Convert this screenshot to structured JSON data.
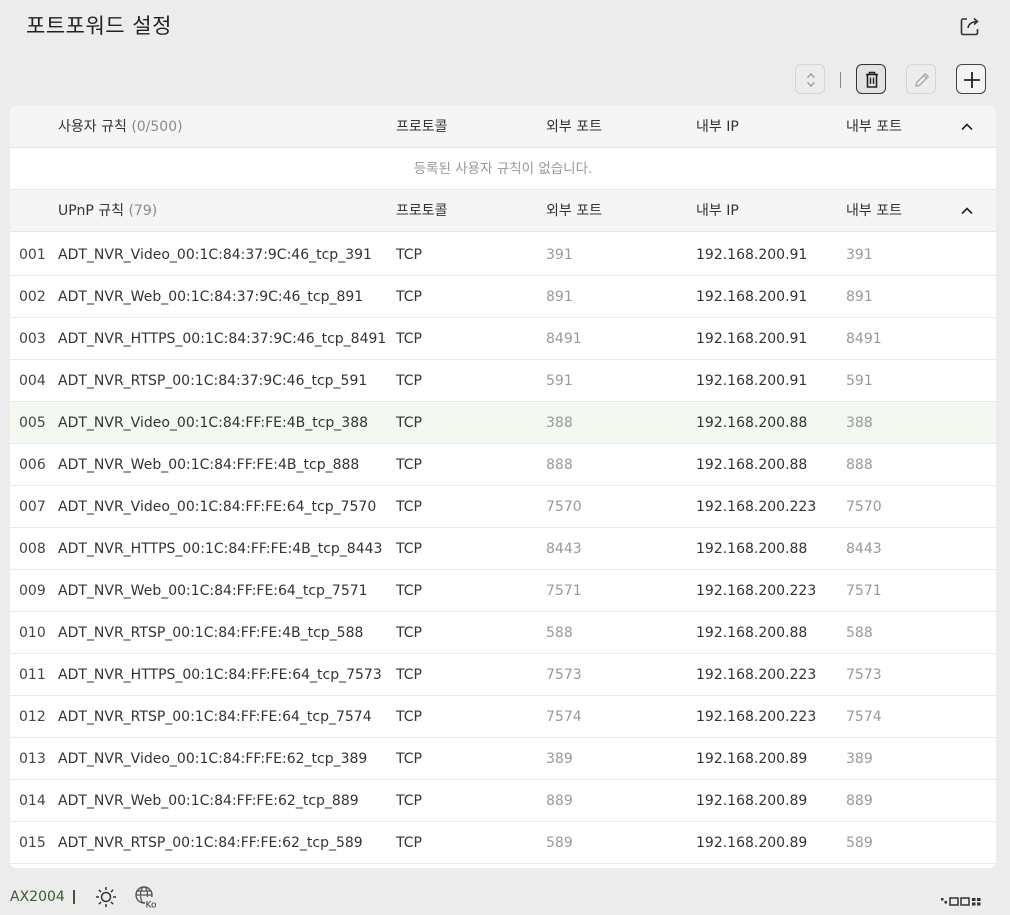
{
  "header": {
    "title": "포트포워드 설정"
  },
  "icons": {
    "export": "export-icon",
    "sort": "sort-icon",
    "delete": "trash-icon",
    "edit": "pencil-icon",
    "add": "plus-icon",
    "collapse": "chevron-up-icon",
    "brightness": "sun-icon",
    "language": "globe-icon",
    "layout": "layout-grid-icon"
  },
  "user_rules": {
    "title": "사용자 규칙",
    "count": "(0/500)",
    "columns": {
      "protocol": "프로토콜",
      "external_port": "외부 포트",
      "internal_ip": "내부 IP",
      "internal_port": "내부 포트"
    },
    "empty_message": "등록된 사용자 규칙이 없습니다."
  },
  "upnp_rules": {
    "title": "UPnP 규칙",
    "count": "(79)",
    "columns": {
      "protocol": "프로토콜",
      "external_port": "외부 포트",
      "internal_ip": "내부 IP",
      "internal_port": "내부 포트"
    },
    "rows": [
      {
        "no": "001",
        "name": "ADT_NVR_Video_00:1C:84:37:9C:46_tcp_391",
        "protocol": "TCP",
        "external_port": "391",
        "internal_ip": "192.168.200.91",
        "internal_port": "391"
      },
      {
        "no": "002",
        "name": "ADT_NVR_Web_00:1C:84:37:9C:46_tcp_891",
        "protocol": "TCP",
        "external_port": "891",
        "internal_ip": "192.168.200.91",
        "internal_port": "891"
      },
      {
        "no": "003",
        "name": "ADT_NVR_HTTPS_00:1C:84:37:9C:46_tcp_8491",
        "protocol": "TCP",
        "external_port": "8491",
        "internal_ip": "192.168.200.91",
        "internal_port": "8491"
      },
      {
        "no": "004",
        "name": "ADT_NVR_RTSP_00:1C:84:37:9C:46_tcp_591",
        "protocol": "TCP",
        "external_port": "591",
        "internal_ip": "192.168.200.91",
        "internal_port": "591"
      },
      {
        "no": "005",
        "name": "ADT_NVR_Video_00:1C:84:FF:FE:4B_tcp_388",
        "protocol": "TCP",
        "external_port": "388",
        "internal_ip": "192.168.200.88",
        "internal_port": "388"
      },
      {
        "no": "006",
        "name": "ADT_NVR_Web_00:1C:84:FF:FE:4B_tcp_888",
        "protocol": "TCP",
        "external_port": "888",
        "internal_ip": "192.168.200.88",
        "internal_port": "888"
      },
      {
        "no": "007",
        "name": "ADT_NVR_Video_00:1C:84:FF:FE:64_tcp_7570",
        "protocol": "TCP",
        "external_port": "7570",
        "internal_ip": "192.168.200.223",
        "internal_port": "7570"
      },
      {
        "no": "008",
        "name": "ADT_NVR_HTTPS_00:1C:84:FF:FE:4B_tcp_8443",
        "protocol": "TCP",
        "external_port": "8443",
        "internal_ip": "192.168.200.88",
        "internal_port": "8443"
      },
      {
        "no": "009",
        "name": "ADT_NVR_Web_00:1C:84:FF:FE:64_tcp_7571",
        "protocol": "TCP",
        "external_port": "7571",
        "internal_ip": "192.168.200.223",
        "internal_port": "7571"
      },
      {
        "no": "010",
        "name": "ADT_NVR_RTSP_00:1C:84:FF:FE:4B_tcp_588",
        "protocol": "TCP",
        "external_port": "588",
        "internal_ip": "192.168.200.88",
        "internal_port": "588"
      },
      {
        "no": "011",
        "name": "ADT_NVR_HTTPS_00:1C:84:FF:FE:64_tcp_7573",
        "protocol": "TCP",
        "external_port": "7573",
        "internal_ip": "192.168.200.223",
        "internal_port": "7573"
      },
      {
        "no": "012",
        "name": "ADT_NVR_RTSP_00:1C:84:FF:FE:64_tcp_7574",
        "protocol": "TCP",
        "external_port": "7574",
        "internal_ip": "192.168.200.223",
        "internal_port": "7574"
      },
      {
        "no": "013",
        "name": "ADT_NVR_Video_00:1C:84:FF:FE:62_tcp_389",
        "protocol": "TCP",
        "external_port": "389",
        "internal_ip": "192.168.200.89",
        "internal_port": "389"
      },
      {
        "no": "014",
        "name": "ADT_NVR_Web_00:1C:84:FF:FE:62_tcp_889",
        "protocol": "TCP",
        "external_port": "889",
        "internal_ip": "192.168.200.89",
        "internal_port": "889"
      },
      {
        "no": "015",
        "name": "ADT_NVR_RTSP_00:1C:84:FF:FE:62_tcp_589",
        "protocol": "TCP",
        "external_port": "589",
        "internal_ip": "192.168.200.89",
        "internal_port": "589"
      }
    ]
  },
  "footer": {
    "model": "AX2004",
    "language_badge": "Ko"
  },
  "colors": {
    "highlight_row": "#f3f8f1",
    "model_text": "#3d5a2c",
    "secondary_text": "#999999"
  }
}
